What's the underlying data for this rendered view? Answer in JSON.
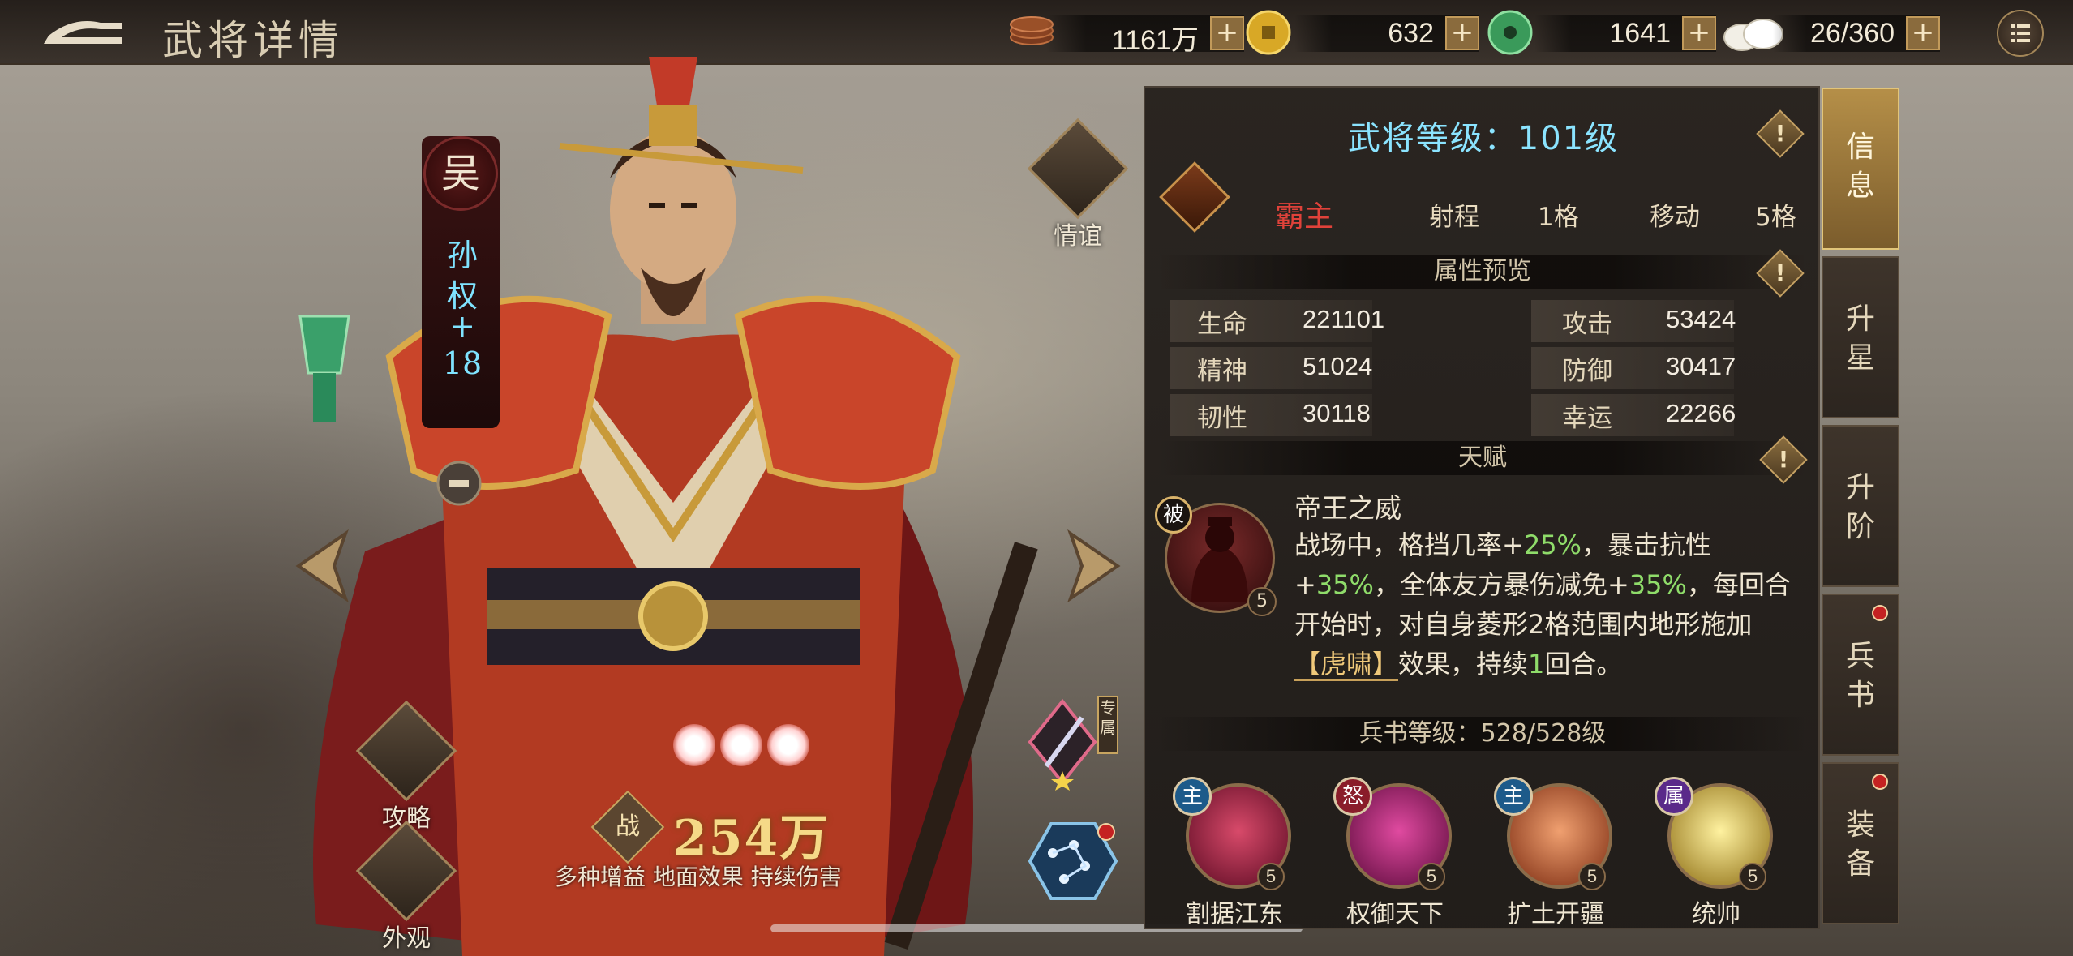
{
  "header": {
    "title": "武将详情",
    "resources": [
      {
        "name": "copper-coins",
        "value": "1161万"
      },
      {
        "name": "gold-ingot",
        "value": "632"
      },
      {
        "name": "jade",
        "value": "1641"
      },
      {
        "name": "stamina-buns",
        "value": "26/360"
      }
    ],
    "plus_label": "+"
  },
  "general": {
    "faction": "吴",
    "name_chars": [
      "孙",
      "权",
      "+",
      "18"
    ],
    "power": "254万",
    "power_icon_char": "战",
    "tags": "多种增益 地面效果 持续伤害",
    "exclusive_label": "专属"
  },
  "side_buttons": {
    "friendship": "情谊",
    "strategy": "攻略",
    "appearance": "外观"
  },
  "panel": {
    "level_title": "武将等级：101级",
    "class_name": "霸主",
    "range_label": "射程",
    "range_value": "1格",
    "move_label": "移动",
    "move_value": "5格",
    "info_mark": "!",
    "attr_header": "属性预览",
    "stats": [
      {
        "label": "生命",
        "value": "221101"
      },
      {
        "label": "攻击",
        "value": "53424"
      },
      {
        "label": "精神",
        "value": "51024"
      },
      {
        "label": "防御",
        "value": "30417"
      },
      {
        "label": "韧性",
        "value": "30118"
      },
      {
        "label": "幸运",
        "value": "22266"
      }
    ],
    "talent_header": "天赋",
    "talent": {
      "badge": "被",
      "level": "5",
      "name": "帝王之威",
      "desc_parts": [
        "战场中，格挡几率+",
        "25%",
        "，暴击抗性+",
        "35%",
        "，全体友方暴伤减免+",
        "35%",
        "，每回合开始时，对自身菱形2格范围内地形施加",
        "【虎啸】",
        "效果，持续",
        "1",
        "回合。"
      ]
    },
    "book_header": "兵书等级：528/528级",
    "books": [
      {
        "badge": "主",
        "name": "割据江东",
        "level": "5",
        "badge_color": "#1d5a8a"
      },
      {
        "badge": "怒",
        "name": "权御天下",
        "level": "5",
        "badge_color": "#8a1d2a"
      },
      {
        "badge": "主",
        "name": "扩土开疆",
        "level": "5",
        "badge_color": "#1d5a8a"
      },
      {
        "badge": "属",
        "name": "统帅",
        "level": "5",
        "badge_color": "#5a2a8a"
      }
    ]
  },
  "tabs": [
    {
      "label": "信息",
      "active": true,
      "dot": false
    },
    {
      "label": "升星",
      "active": false,
      "dot": false
    },
    {
      "label": "升阶",
      "active": false,
      "dot": false
    },
    {
      "label": "兵书",
      "active": false,
      "dot": true
    },
    {
      "label": "装备",
      "active": false,
      "dot": true
    }
  ]
}
